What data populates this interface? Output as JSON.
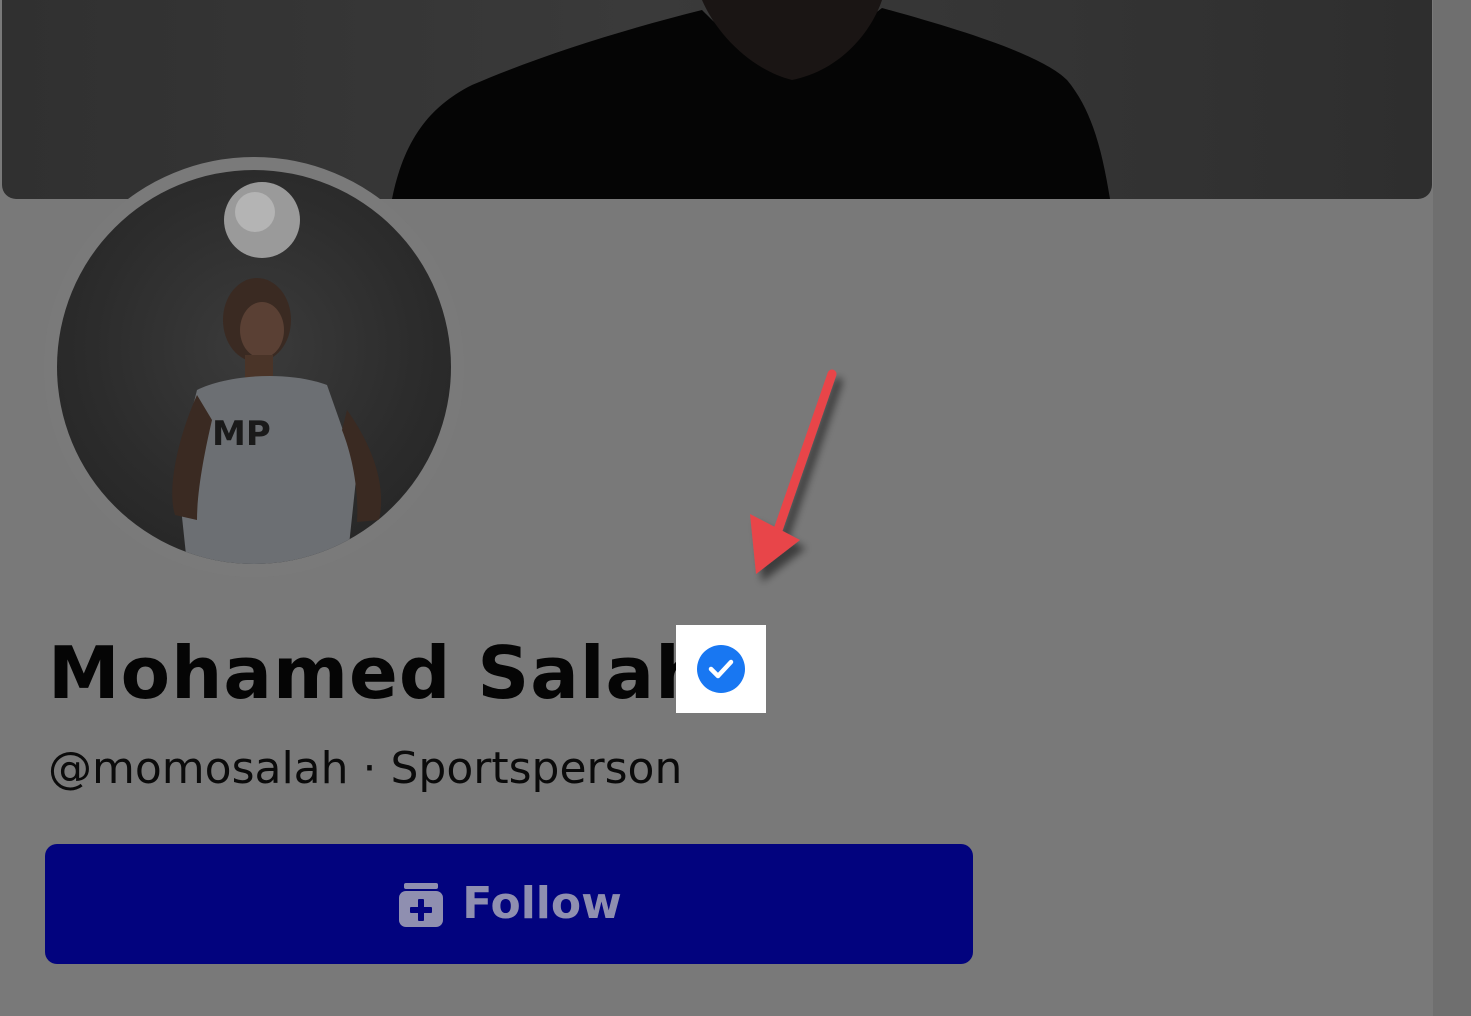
{
  "profile": {
    "name": "Mohamed Salah",
    "subtitle": "@momosalah · Sportsperson",
    "verified": true
  },
  "actions": {
    "follow_label": "Follow"
  },
  "annotation": {
    "arrow_color": "#e8444a",
    "highlight_target": "verified-badge"
  },
  "colors": {
    "follow_button": "#02037e",
    "verified_badge": "#1877f2",
    "overlay": "#797979"
  }
}
